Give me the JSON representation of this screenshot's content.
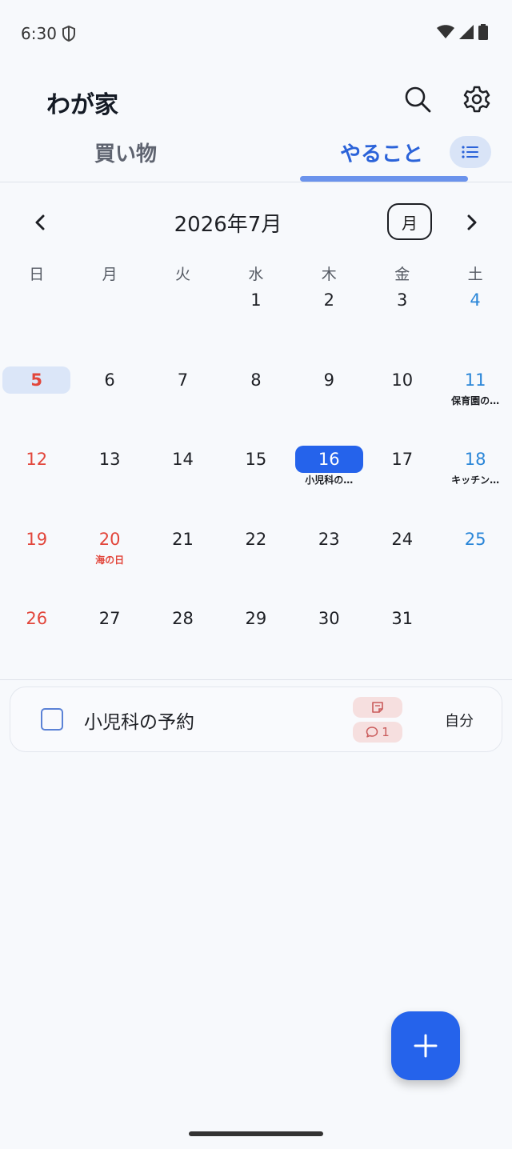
{
  "status_bar": {
    "time": "6:30"
  },
  "header": {
    "title": "わが家"
  },
  "tabs": {
    "shopping": "買い物",
    "todo": "やること"
  },
  "calendar": {
    "month_label": "2026年7月",
    "view_mode": "月",
    "weekdays": [
      "日",
      "月",
      "火",
      "水",
      "木",
      "金",
      "土"
    ],
    "days": [
      {
        "d": "1"
      },
      {
        "d": "2"
      },
      {
        "d": "3"
      },
      {
        "d": "4"
      },
      {
        "d": "5"
      },
      {
        "d": "6"
      },
      {
        "d": "7"
      },
      {
        "d": "8"
      },
      {
        "d": "9"
      },
      {
        "d": "10"
      },
      {
        "d": "11",
        "event": "保育園の…"
      },
      {
        "d": "12"
      },
      {
        "d": "13"
      },
      {
        "d": "14"
      },
      {
        "d": "15"
      },
      {
        "d": "16",
        "event": "小児科の…"
      },
      {
        "d": "17"
      },
      {
        "d": "18",
        "event": "キッチン…"
      },
      {
        "d": "19"
      },
      {
        "d": "20",
        "event": "海の日"
      },
      {
        "d": "21"
      },
      {
        "d": "22"
      },
      {
        "d": "23"
      },
      {
        "d": "24"
      },
      {
        "d": "25"
      },
      {
        "d": "26"
      },
      {
        "d": "27"
      },
      {
        "d": "28"
      },
      {
        "d": "29"
      },
      {
        "d": "30"
      },
      {
        "d": "31"
      }
    ]
  },
  "task": {
    "title": "小児科の予約",
    "comment_count": "1",
    "assignee": "自分"
  },
  "colors": {
    "accent": "#2563eb",
    "sunday": "#e2463b",
    "saturday": "#2a86d8"
  }
}
